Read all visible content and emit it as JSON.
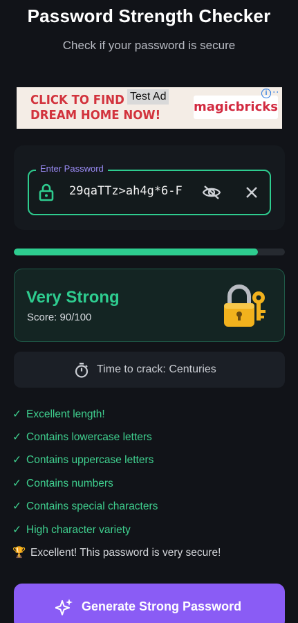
{
  "header": {
    "title": "Password Strength Checker",
    "subtitle": "Check if your password is secure"
  },
  "ad": {
    "headline_line1": "CLICK TO FIND YOUR",
    "headline_line2": "DREAM HOME NOW!",
    "label": "Test Ad",
    "brand": "magicbricks",
    "info_icon": "info-icon",
    "info_glyph": "i"
  },
  "password_input": {
    "label": "Enter Password",
    "value": "29qaTTz>ah4g*6-F",
    "lock_icon": "lock-icon",
    "visibility_icon": "eye-off-icon",
    "clear_icon": "close-icon"
  },
  "strength": {
    "progress": 0.9,
    "level": "Very Strong",
    "score": "Score: 90/100",
    "icon": "padlock-key-icon",
    "accent_color": "#2ecc8f"
  },
  "crack_time": {
    "icon": "stopwatch-icon",
    "text": "Time to crack: Centuries"
  },
  "checks": {
    "mark": "✓",
    "items": [
      "Excellent length!",
      "Contains lowercase letters",
      "Contains uppercase letters",
      "Contains numbers",
      "Contains special characters",
      "High character variety"
    ]
  },
  "summary": {
    "icon": "trophy-icon",
    "glyph": "🏆",
    "text": "Excellent! This password is very secure!"
  },
  "generate_button": {
    "label": "Generate Strong Password",
    "icon": "sparkle-icon",
    "color": "#8a5cf5"
  }
}
